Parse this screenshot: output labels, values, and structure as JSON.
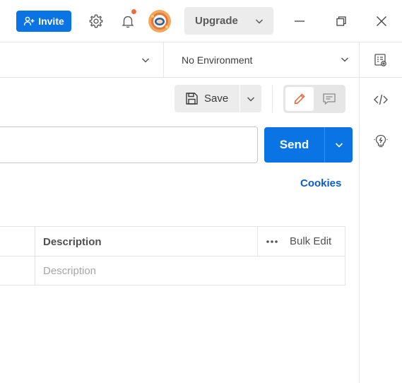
{
  "titlebar": {
    "invite_label": "Invite",
    "upgrade_label": "Upgrade",
    "icons": [
      "user-plus-icon",
      "gear-icon",
      "bell-icon",
      "avatar",
      "minimize-icon",
      "restore-icon",
      "close-icon"
    ],
    "notification_dot_color": "#f26b3a"
  },
  "environment": {
    "selected": "No Environment"
  },
  "toolbar": {
    "save_label": "Save"
  },
  "request": {
    "url_value": "",
    "send_label": "Send",
    "cookies_label": "Cookies"
  },
  "params_table": {
    "headers": {
      "description": "Description",
      "bulk_edit": "Bulk Edit"
    },
    "rows": [
      {
        "description_placeholder": "Description"
      }
    ]
  },
  "right_sidebar": {
    "icons": [
      "code-icon",
      "lightbulb-icon"
    ]
  },
  "colors": {
    "primary": "#0b74e5",
    "link": "#0b5fc4",
    "accent_orange": "#f26b3a"
  }
}
